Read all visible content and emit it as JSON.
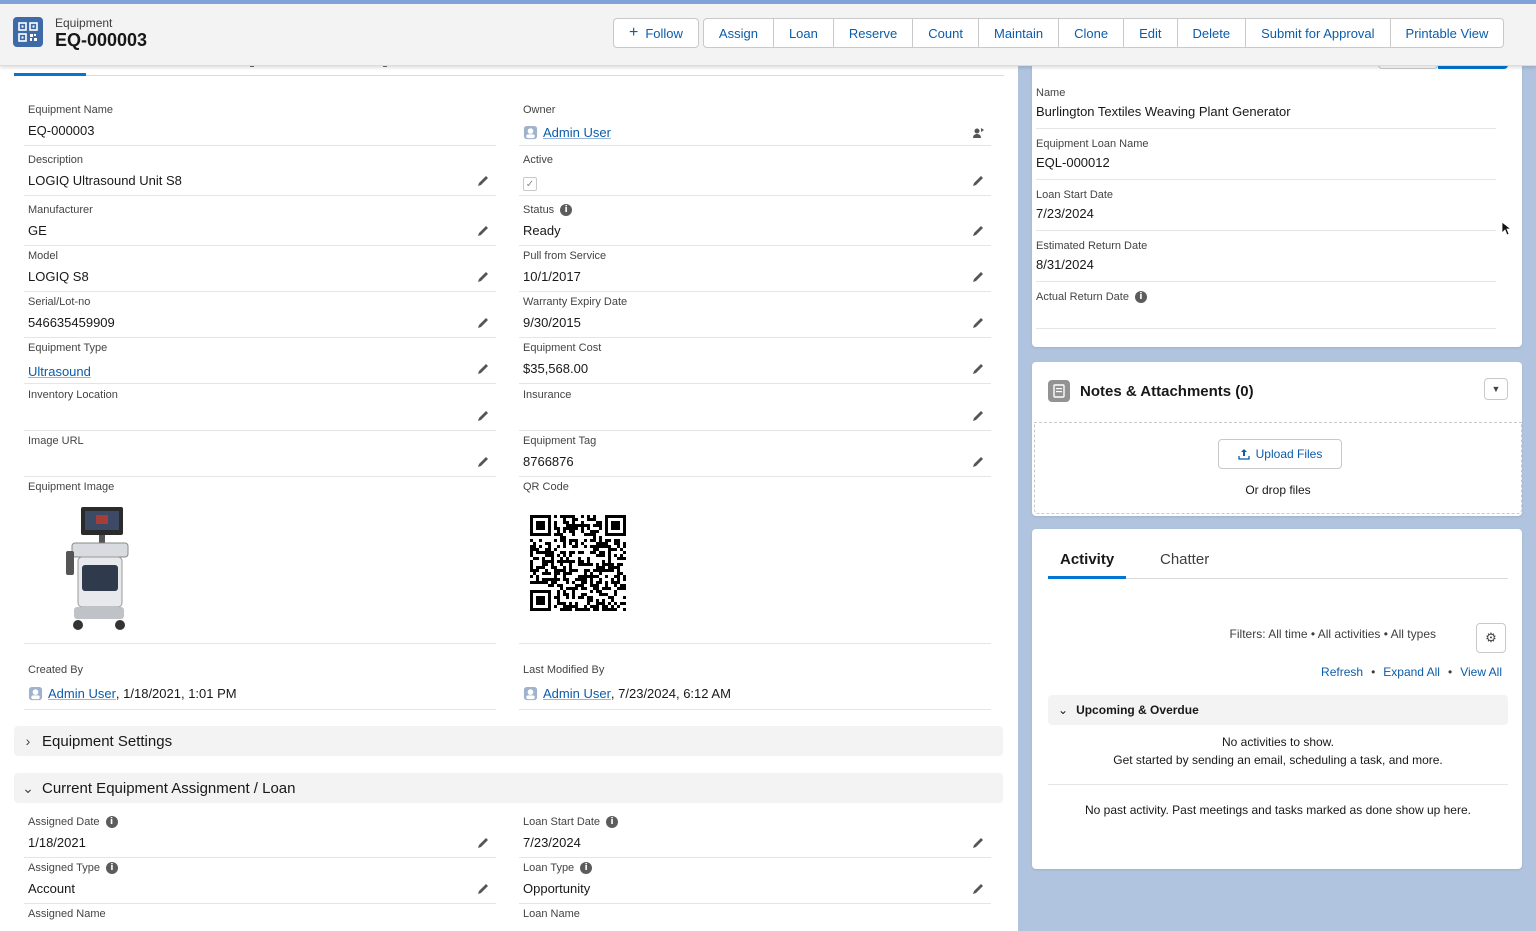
{
  "header": {
    "object_name": "Equipment",
    "record_name": "EQ-000003",
    "follow_label": "Follow",
    "actions": [
      "Assign",
      "Loan",
      "Reserve",
      "Count",
      "Maintain",
      "Clone",
      "Edit",
      "Delete",
      "Submit for Approval",
      "Printable View"
    ]
  },
  "details": {
    "equipment_name": {
      "label": "Equipment Name",
      "value": "EQ-000003"
    },
    "owner": {
      "label": "Owner",
      "value": "Admin User"
    },
    "description": {
      "label": "Description",
      "value": "LOGIQ Ultrasound Unit S8"
    },
    "active": {
      "label": "Active",
      "value": "✓"
    },
    "manufacturer": {
      "label": "Manufacturer",
      "value": "GE"
    },
    "status": {
      "label": "Status",
      "value": "Ready"
    },
    "model": {
      "label": "Model",
      "value": "LOGIQ S8"
    },
    "pull_from_service": {
      "label": "Pull from Service",
      "value": "10/1/2017"
    },
    "serial": {
      "label": "Serial/Lot-no",
      "value": "546635459909"
    },
    "warranty": {
      "label": "Warranty Expiry Date",
      "value": "9/30/2015"
    },
    "equipment_type": {
      "label": "Equipment Type",
      "value": "Ultrasound"
    },
    "equipment_cost": {
      "label": "Equipment Cost",
      "value": "$35,568.00"
    },
    "inventory_location": {
      "label": "Inventory Location",
      "value": ""
    },
    "insurance": {
      "label": "Insurance",
      "value": ""
    },
    "image_url": {
      "label": "Image URL",
      "value": ""
    },
    "equipment_tag": {
      "label": "Equipment Tag",
      "value": "8766876"
    },
    "equipment_image": {
      "label": "Equipment Image"
    },
    "qr_code": {
      "label": "QR Code"
    },
    "created_by": {
      "label": "Created By",
      "user": "Admin User",
      "date": ", 1/18/2021, 1:01 PM"
    },
    "last_modified_by": {
      "label": "Last Modified By",
      "user": "Admin User",
      "date": ", 7/23/2024, 6:12 AM"
    }
  },
  "sections": {
    "equipment_settings": "Equipment Settings",
    "current_assignment": "Current Equipment Assignment / Loan"
  },
  "assignment": {
    "assigned_date": {
      "label": "Assigned Date",
      "value": "1/18/2021"
    },
    "loan_start_date": {
      "label": "Loan Start Date",
      "value": "7/23/2024"
    },
    "assigned_type": {
      "label": "Assigned Type",
      "value": "Account"
    },
    "loan_type": {
      "label": "Loan Type",
      "value": "Opportunity"
    },
    "assigned_name": {
      "label": "Assigned Name"
    },
    "loan_name": {
      "label": "Loan Name"
    }
  },
  "loan_card": {
    "name": {
      "label": "Name",
      "value": "Burlington Textiles Weaving Plant Generator"
    },
    "loan_name": {
      "label": "Equipment Loan Name",
      "value": "EQL-000012"
    },
    "start_date": {
      "label": "Loan Start Date",
      "value": "7/23/2024"
    },
    "est_return": {
      "label": "Estimated Return Date",
      "value": "8/31/2024"
    },
    "actual_return": {
      "label": "Actual Return Date",
      "value": ""
    }
  },
  "notes": {
    "title": "Notes & Attachments (0)",
    "upload_label": "Upload Files",
    "drop_text": "Or drop files"
  },
  "activity": {
    "tabs": [
      "Activity",
      "Chatter"
    ],
    "filters": "Filters: All time • All activities • All types",
    "links": [
      "Refresh",
      "Expand All",
      "View All"
    ],
    "upcoming": "Upcoming & Overdue",
    "no_activity": "No activities to show.",
    "get_started": "Get started by sending an email, scheduling a task, and more.",
    "no_past": "No past activity. Past meetings and tasks marked as done show up here."
  },
  "colors": {
    "brand": "#0176d3",
    "link": "#0b5cab",
    "background": "#b0c4df"
  }
}
